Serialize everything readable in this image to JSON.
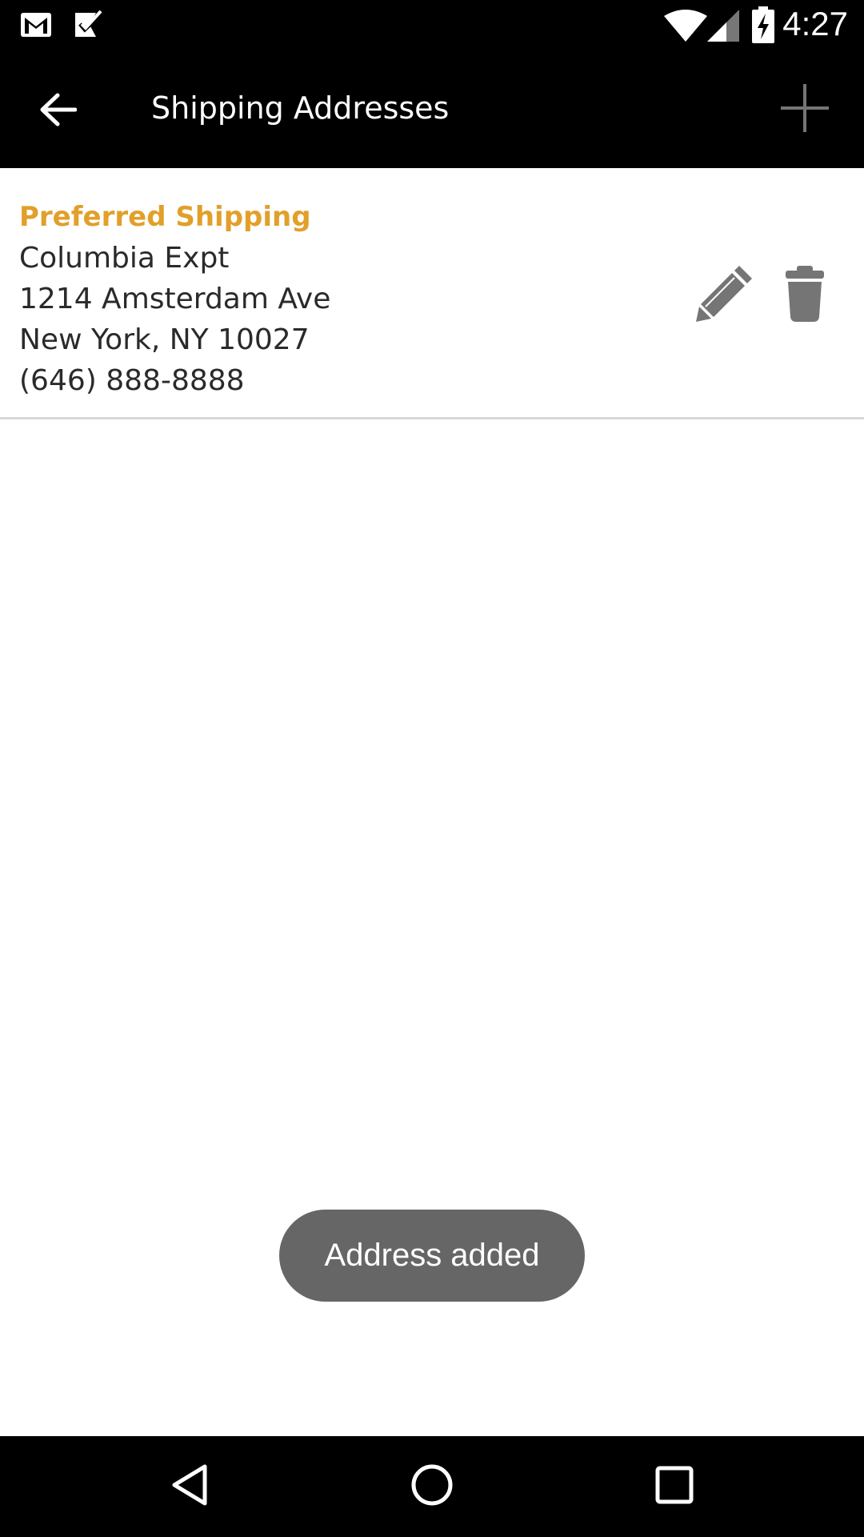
{
  "status_bar": {
    "time": "4:27",
    "icons": [
      "gmail-icon",
      "tasks-check-icon",
      "wifi-icon",
      "signal-icon",
      "battery-charging-icon"
    ]
  },
  "app_bar": {
    "title": "Shipping Addresses",
    "back_icon": "arrow-left-icon",
    "add_icon": "plus-icon"
  },
  "addresses": [
    {
      "label": "Preferred Shipping",
      "name": "Columbia Expt",
      "street": "1214 Amsterdam Ave",
      "city_state_zip": "New York, NY 10027",
      "phone": "(646) 888-8888",
      "edit_icon": "pencil-icon",
      "delete_icon": "trash-icon"
    }
  ],
  "toast": {
    "message": "Address added"
  },
  "nav_bar": {
    "icons": [
      "back-triangle-icon",
      "home-circle-icon",
      "recents-square-icon"
    ]
  },
  "colors": {
    "accent": "#e1a02a",
    "bar_background": "#000000",
    "icon_gray": "#757575",
    "toast_background": "#666666"
  }
}
